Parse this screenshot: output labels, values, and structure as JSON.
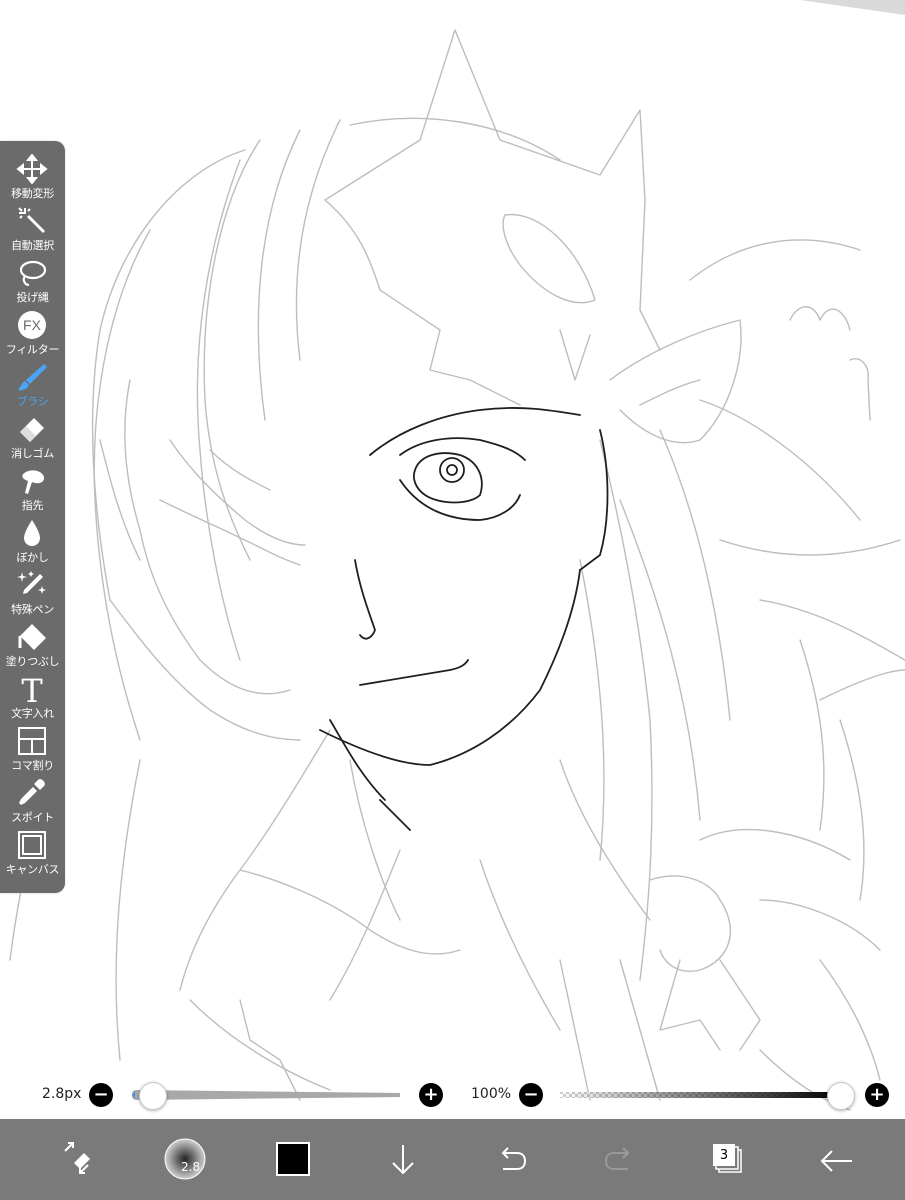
{
  "toolbar": {
    "tools": [
      {
        "label": "移動変形",
        "icon": "move-transform-icon"
      },
      {
        "label": "自動選択",
        "icon": "magic-wand-icon"
      },
      {
        "label": "投げ縄",
        "icon": "lasso-icon"
      },
      {
        "label": "フィルター",
        "icon": "fx-filter-icon"
      },
      {
        "label": "ブラシ",
        "icon": "brush-icon",
        "active": true
      },
      {
        "label": "消しゴム",
        "icon": "eraser-icon"
      },
      {
        "label": "指先",
        "icon": "finger-smudge-icon"
      },
      {
        "label": "ぼかし",
        "icon": "blur-drop-icon"
      },
      {
        "label": "特殊ペン",
        "icon": "special-pen-icon"
      },
      {
        "label": "塗りつぶし",
        "icon": "fill-bucket-icon"
      },
      {
        "label": "文字入れ",
        "icon": "text-icon"
      },
      {
        "label": "コマ割り",
        "icon": "frame-divider-icon"
      },
      {
        "label": "スポイト",
        "icon": "eyedropper-icon"
      },
      {
        "label": "キャンバス",
        "icon": "canvas-icon"
      }
    ],
    "fx_text": "FX",
    "text_glyph": "T"
  },
  "brush_size": {
    "value_text": "2.8px",
    "level": 0.02
  },
  "opacity": {
    "value_text": "100%",
    "level": 1.0
  },
  "bottom": {
    "brush_preview_size": "2.8",
    "color": "#000000",
    "layer_count": "3"
  },
  "colors": {
    "accent": "#4aa3f3",
    "toolbar_bg": "#6b6b6b",
    "bottom_bar_bg": "#7a7a7a"
  }
}
